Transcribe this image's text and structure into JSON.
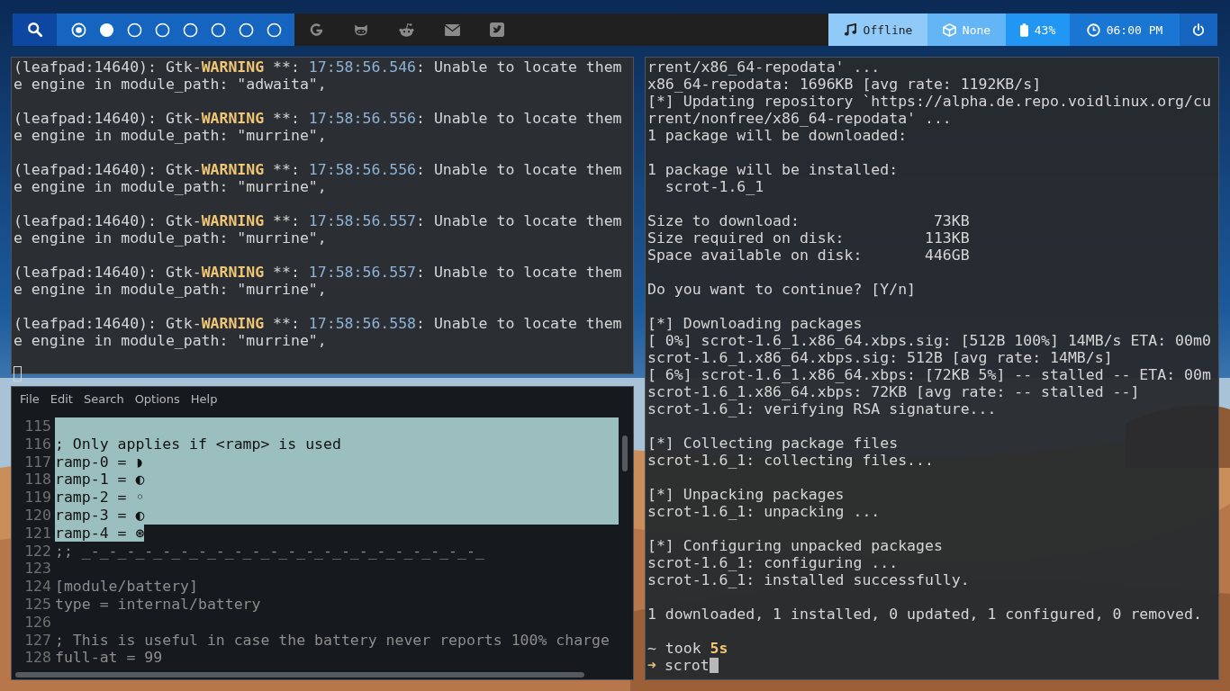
{
  "top_bar": {
    "workspaces": [
      {
        "kind": "current"
      },
      {
        "kind": "occupied"
      },
      {
        "kind": "empty"
      },
      {
        "kind": "empty"
      },
      {
        "kind": "empty"
      },
      {
        "kind": "empty"
      },
      {
        "kind": "empty"
      },
      {
        "kind": "empty"
      }
    ],
    "links": [
      {
        "kind": "google"
      },
      {
        "kind": "github"
      },
      {
        "kind": "reddit"
      },
      {
        "kind": "mail"
      },
      {
        "kind": "twitter"
      }
    ],
    "modules": [
      {
        "kind": "music",
        "label": "Offline"
      },
      {
        "kind": "package",
        "label": "None"
      },
      {
        "kind": "battery",
        "label": "43%"
      },
      {
        "kind": "clock",
        "label": "06:00 PM"
      },
      {
        "kind": "power"
      }
    ]
  },
  "log_terminal": {
    "entries": [
      {
        "process": "(leafpad:14640): Gtk-",
        "level": "WARNING",
        "sep": " **: ",
        "time": "17:58:56.546",
        "message": ": Unable to locate them",
        "continuation": "e engine in module_path: \"adwaita\","
      },
      {
        "process": "(leafpad:14640): Gtk-",
        "level": "WARNING",
        "sep": " **: ",
        "time": "17:58:56.556",
        "message": ": Unable to locate them",
        "continuation": "e engine in module_path: \"murrine\","
      },
      {
        "process": "(leafpad:14640): Gtk-",
        "level": "WARNING",
        "sep": " **: ",
        "time": "17:58:56.556",
        "message": ": Unable to locate them",
        "continuation": "e engine in module_path: \"murrine\","
      },
      {
        "process": "(leafpad:14640): Gtk-",
        "level": "WARNING",
        "sep": " **: ",
        "time": "17:58:56.557",
        "message": ": Unable to locate them",
        "continuation": "e engine in module_path: \"murrine\","
      },
      {
        "process": "(leafpad:14640): Gtk-",
        "level": "WARNING",
        "sep": " **: ",
        "time": "17:58:56.557",
        "message": ": Unable to locate them",
        "continuation": "e engine in module_path: \"murrine\","
      },
      {
        "process": "(leafpad:14640): Gtk-",
        "level": "WARNING",
        "sep": " **: ",
        "time": "17:58:56.558",
        "message": ": Unable to locate them",
        "continuation": "e engine in module_path: \"murrine\","
      }
    ]
  },
  "editor": {
    "menu": [
      "File",
      "Edit",
      "Search",
      "Options",
      "Help"
    ],
    "lines": [
      {
        "number": "115",
        "selected": true
      },
      {
        "number": "116",
        "text": "; Only applies if <ramp> is used",
        "selected": true
      },
      {
        "number": "117",
        "text": "ramp-0 = ◗",
        "selected": true
      },
      {
        "number": "118",
        "text": "ramp-1 = ◐",
        "selected": true
      },
      {
        "number": "119",
        "text": "ramp-2 = ◦",
        "selected": true
      },
      {
        "number": "120",
        "text": "ramp-3 = ◐",
        "selected": true
      },
      {
        "number": "121",
        "text": "ramp-4 = ⊛",
        "selected": true
      },
      {
        "number": "122",
        "text": ";; _-_-_-_-_-_-_-_-_-_-_-_-_-_-_-_-_-_-_-_-_-_-_",
        "selected": false
      },
      {
        "number": "123",
        "selected": false
      },
      {
        "number": "124",
        "text": "[module/battery]",
        "selected": false
      },
      {
        "number": "125",
        "text": "type = internal/battery",
        "selected": false
      },
      {
        "number": "126",
        "selected": false
      },
      {
        "number": "127",
        "text": "; This is useful in case the battery never reports 100% charge",
        "selected": false
      },
      {
        "number": "128",
        "text": "full-at = 99",
        "selected": false
      }
    ]
  },
  "install_terminal": {
    "blocks": [
      [
        "rrent/x86_64-repodata' ...",
        "x86_64-repodata: 1696KB [avg rate: 1192KB/s]",
        "[*] Updating repository `https://alpha.de.repo.voidlinux.org/cu",
        "rrent/nonfree/x86_64-repodata' ...",
        "1 package will be downloaded:"
      ],
      [
        "1 package will be installed:",
        "  scrot-1.6_1"
      ],
      [
        "Size to download:               73KB",
        "Size required on disk:         113KB",
        "Space available on disk:       446GB"
      ],
      [
        "Do you want to continue? [Y/n]"
      ],
      [
        "[*] Downloading packages",
        "[ 0%] scrot-1.6_1.x86_64.xbps.sig: [512B 100%] 14MB/s ETA: 00m0",
        "scrot-1.6_1.x86_64.xbps.sig: 512B [avg rate: 14MB/s]",
        "[ 6%] scrot-1.6_1.x86_64.xbps: [72KB 5%] -- stalled -- ETA: 00m",
        "scrot-1.6_1.x86_64.xbps: 72KB [avg rate: -- stalled --]",
        "scrot-1.6_1: verifying RSA signature..."
      ],
      [
        "[*] Collecting package files",
        "scrot-1.6_1: collecting files..."
      ],
      [
        "[*] Unpacking packages",
        "scrot-1.6_1: unpacking ..."
      ],
      [
        "[*] Configuring unpacked packages",
        "scrot-1.6_1: configuring ...",
        "scrot-1.6_1: installed successfully."
      ],
      [
        "1 downloaded, 1 installed, 0 updated, 1 configured, 0 removed."
      ]
    ],
    "prompt": {
      "status": "~ took **5s**",
      "symbol": "➜",
      "command": "scrot"
    }
  }
}
